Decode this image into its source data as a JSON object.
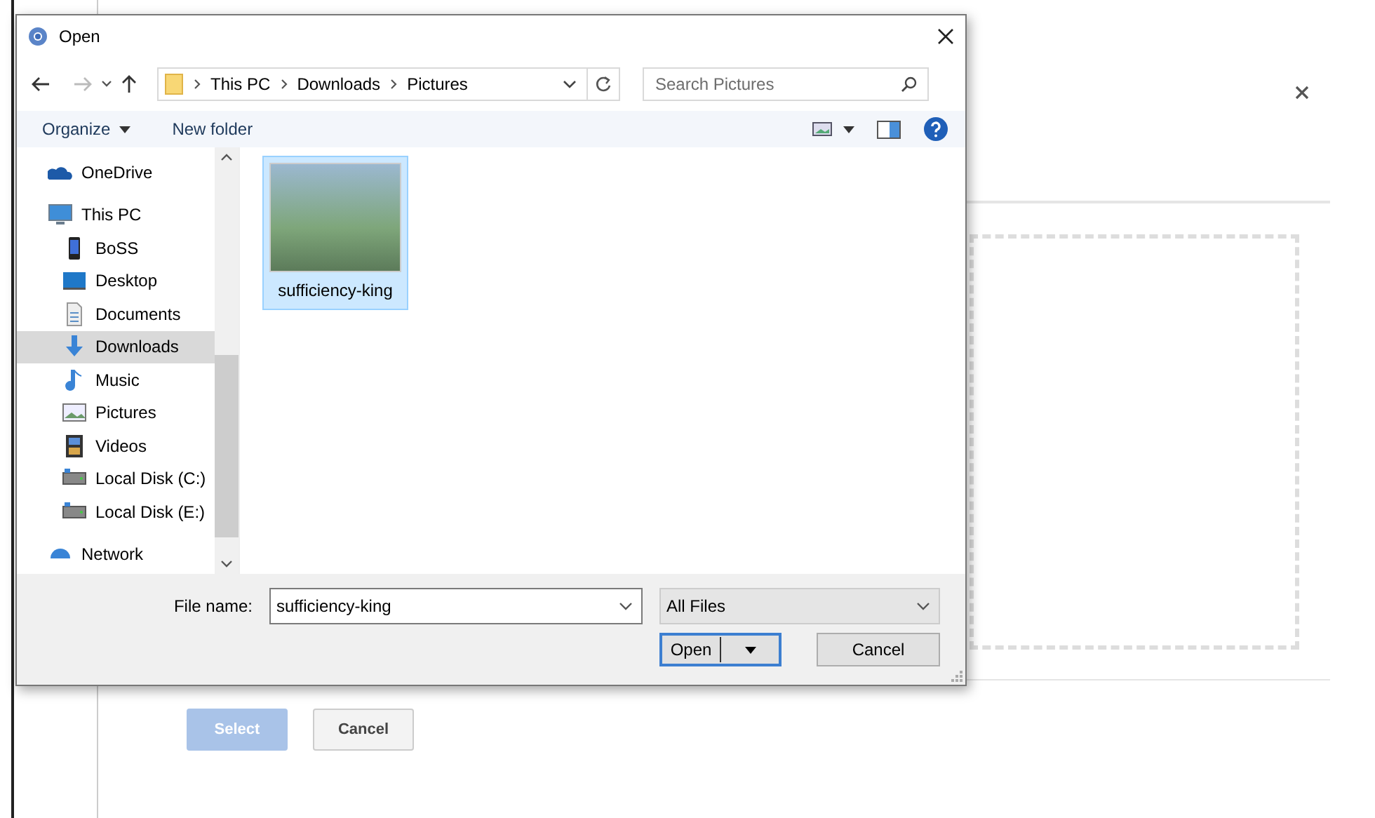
{
  "dialog": {
    "title": "Open",
    "path": [
      "This PC",
      "Downloads",
      "Pictures"
    ],
    "search": {
      "placeholder": "Search Pictures"
    },
    "toolbar": {
      "organize": "Organize",
      "new_folder": "New folder"
    },
    "nav_items": [
      {
        "label": "OneDrive",
        "kind": "cloud",
        "selected": false
      },
      {
        "label": "This PC",
        "kind": "pc",
        "selected": false,
        "children": [
          {
            "label": "BoSS",
            "kind": "phone",
            "selected": false
          },
          {
            "label": "Desktop",
            "kind": "desktop",
            "selected": false
          },
          {
            "label": "Documents",
            "kind": "document",
            "selected": false
          },
          {
            "label": "Downloads",
            "kind": "download",
            "selected": true
          },
          {
            "label": "Music",
            "kind": "music",
            "selected": false
          },
          {
            "label": "Pictures",
            "kind": "picture",
            "selected": false
          },
          {
            "label": "Videos",
            "kind": "video",
            "selected": false
          },
          {
            "label": "Local Disk (C:)",
            "kind": "disk",
            "selected": false
          },
          {
            "label": "Local Disk (E:)",
            "kind": "disk",
            "selected": false
          }
        ]
      },
      {
        "label": "Network",
        "kind": "network",
        "selected": false
      }
    ],
    "files": [
      {
        "name": "sufficiency-king",
        "selected": true
      }
    ],
    "file_name": {
      "label": "File name:",
      "value": "sufficiency-king"
    },
    "file_type": "All Files",
    "buttons": {
      "open": "Open",
      "cancel": "Cancel"
    }
  },
  "page": {
    "buttons": [
      {
        "label": "Select",
        "disabled": true
      },
      {
        "label": "Cancel",
        "disabled": false
      }
    ]
  }
}
